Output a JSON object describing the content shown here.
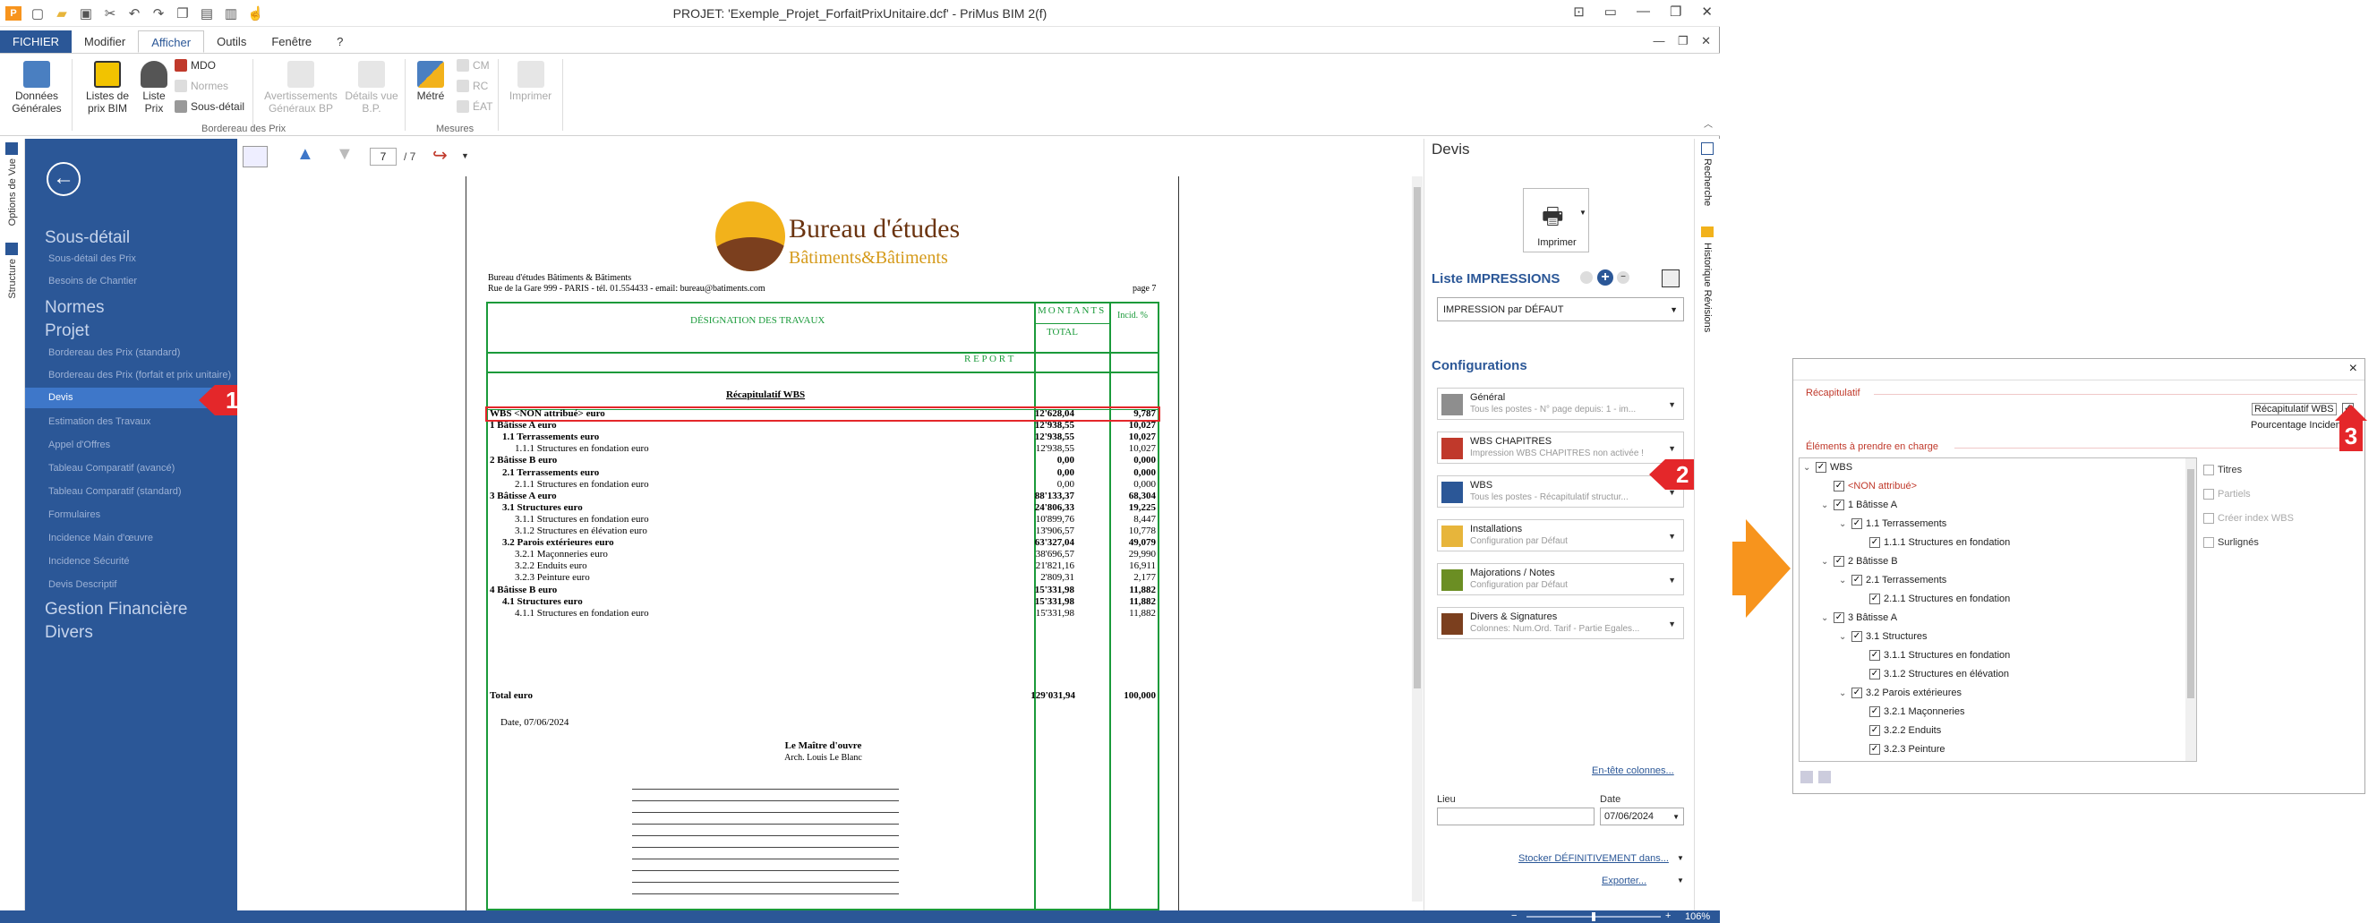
{
  "window": {
    "title": "PROJET: 'Exemple_Projet_ForfaitPrixUnitaire.dcf' - PriMus  BIM 2(f)"
  },
  "ribbon_tabs": [
    "FICHIER",
    "Modifier",
    "Afficher",
    "Outils",
    "Fenêtre",
    "?"
  ],
  "ribbon": {
    "donnees": "Données Générales",
    "listes_bim": "Listes de prix BIM",
    "liste_prix": "Liste Prix",
    "mdo": "MDO",
    "normes": "Normes",
    "sous_detail": "Sous-détail",
    "avertissements": "Avertissements Généraux BP",
    "details_vue": "Détails vue B.P.",
    "metre": "Métré",
    "cm": "CM",
    "rc": "RC",
    "eat": "ÉAT",
    "imprimer": "Imprimer",
    "group_bordereau": "Bordereau des Prix",
    "group_mesures": "Mesures"
  },
  "left_strip": {
    "options_vue": "Options de Vue",
    "structure": "Structure"
  },
  "nav": {
    "sous_detail": "Sous-détail",
    "sous_detail_prix": "Sous-détail des Prix",
    "besoins": "Besoins de Chantier",
    "normes": "Normes",
    "projet": "Projet",
    "bp_standard": "Bordereau des Prix (standard)",
    "bp_forfait": "Bordereau des Prix (forfait et prix unitaire)",
    "devis": "Devis",
    "estimation": "Estimation des Travaux",
    "appel": "Appel d'Offres",
    "tab_avance": "Tableau Comparatif (avancé)",
    "tab_standard": "Tableau Comparatif (standard)",
    "formulaires": "Formulaires",
    "incidence_mo": "Incidence Main d'œuvre",
    "incidence_sec": "Incidence Sécurité",
    "devis_desc": "Devis Descriptif",
    "gestion": "Gestion Financière",
    "divers": "Divers"
  },
  "callouts": {
    "c1": "1",
    "c2": "2",
    "c3": "3"
  },
  "doctoolbar": {
    "page_current": "7",
    "page_total": "/ 7"
  },
  "document": {
    "logo_title": "Bureau d'études",
    "logo_sub": "Bâtiments&Bâtiments",
    "company": "Bureau d'études Bâtiments & Bâtiments",
    "address": "Rue de la Gare 999 - PARIS - tél. 01.554433 - email: bureau@batiments.com",
    "page": "page 7",
    "col_designation": "DÉSIGNATION DES TRAVAUX",
    "col_montants": "MONTANTS",
    "col_total": "TOTAL",
    "col_incid": "Incid. %",
    "report": "R E P O R T",
    "recap_title": "Récapitulatif WBS",
    "rows": [
      {
        "label": "WBS <NON attribué> euro",
        "amount": "12'628,04",
        "pct": "9,787",
        "bold": true,
        "indent": 0
      },
      {
        "label": "1 Bâtisse A euro",
        "amount": "12'938,55",
        "pct": "10,027",
        "bold": true,
        "indent": 0
      },
      {
        "label": "1.1 Terrassements euro",
        "amount": "12'938,55",
        "pct": "10,027",
        "bold": true,
        "indent": 1
      },
      {
        "label": "1.1.1 Structures en fondation euro",
        "amount": "12'938,55",
        "pct": "10,027",
        "bold": false,
        "indent": 2
      },
      {
        "label": "2 Bâtisse B euro",
        "amount": "0,00",
        "pct": "0,000",
        "bold": true,
        "indent": 0
      },
      {
        "label": "2.1 Terrassements euro",
        "amount": "0,00",
        "pct": "0,000",
        "bold": true,
        "indent": 1
      },
      {
        "label": "2.1.1 Structures en fondation euro",
        "amount": "0,00",
        "pct": "0,000",
        "bold": false,
        "indent": 2
      },
      {
        "label": "3 Bâtisse A euro",
        "amount": "88'133,37",
        "pct": "68,304",
        "bold": true,
        "indent": 0
      },
      {
        "label": "3.1 Structures euro",
        "amount": "24'806,33",
        "pct": "19,225",
        "bold": true,
        "indent": 1
      },
      {
        "label": "3.1.1 Structures en fondation euro",
        "amount": "10'899,76",
        "pct": "8,447",
        "bold": false,
        "indent": 2
      },
      {
        "label": "3.1.2 Structures en élévation euro",
        "amount": "13'906,57",
        "pct": "10,778",
        "bold": false,
        "indent": 2
      },
      {
        "label": "3.2 Parois extérieures euro",
        "amount": "63'327,04",
        "pct": "49,079",
        "bold": true,
        "indent": 1
      },
      {
        "label": "3.2.1 Maçonneries euro",
        "amount": "38'696,57",
        "pct": "29,990",
        "bold": false,
        "indent": 2
      },
      {
        "label": "3.2.2 Enduits euro",
        "amount": "21'821,16",
        "pct": "16,911",
        "bold": false,
        "indent": 2
      },
      {
        "label": "3.2.3 Peinture euro",
        "amount": "2'809,31",
        "pct": "2,177",
        "bold": false,
        "indent": 2
      },
      {
        "label": "4 Bâtisse B euro",
        "amount": "15'331,98",
        "pct": "11,882",
        "bold": true,
        "indent": 0
      },
      {
        "label": "4.1 Structures euro",
        "amount": "15'331,98",
        "pct": "11,882",
        "bold": true,
        "indent": 1
      },
      {
        "label": "4.1.1 Structures en fondation euro",
        "amount": "15'331,98",
        "pct": "11,882",
        "bold": false,
        "indent": 2
      }
    ],
    "total_label": "Total euro",
    "total_amount": "129'031,94",
    "total_pct": "100,000",
    "date": "Date, 07/06/2024",
    "signer_title": "Le Maître d'ouvre",
    "signer_name": "Arch. Louis Le Blanc"
  },
  "panel": {
    "title": "Devis",
    "print_label": "Imprimer",
    "liste_title": "Liste IMPRESSIONS",
    "impression_select": "IMPRESSION par DÉFAUT",
    "config_title": "Configurations",
    "configs": [
      {
        "title": "Général",
        "sub": "Tous les postes - N° page depuis: 1 - im..."
      },
      {
        "title": "WBS CHAPITRES",
        "sub": "Impression WBS CHAPITRES non activée !"
      },
      {
        "title": "WBS",
        "sub": "Tous les postes - Récapitulatif structur..."
      },
      {
        "title": "Installations",
        "sub": "Configuration par Défaut"
      },
      {
        "title": "Majorations / Notes",
        "sub": "Configuration par Défaut"
      },
      {
        "title": "Divers & Signatures",
        "sub": "Colonnes: Num.Ord. Tarif - Partie Égales..."
      }
    ],
    "entete": "En-tête colonnes...",
    "lieu_label": "Lieu",
    "date_label": "Date",
    "date_value": "07/06/2024",
    "stocker": "Stocker DÉFINITIVEMENT dans...",
    "exporter": "Exporter..."
  },
  "right_strip": {
    "recherche": "Recherche",
    "historique": "Historique Révisions"
  },
  "status": {
    "zoom": "106%"
  },
  "dialog": {
    "close": "×",
    "recap_section": "Récapitulatif",
    "recap_wbs": "Récapitulatif WBS",
    "pourcentage": "Pourcentage Incidence",
    "elements_section": "Éléments à prendre en charge",
    "tree": [
      {
        "label": "WBS",
        "level": 0,
        "red": false
      },
      {
        "label": "<NON attribué>",
        "level": 1,
        "red": true
      },
      {
        "label": "1  Bâtisse A",
        "level": 1,
        "red": false
      },
      {
        "label": "1.1  Terrassements",
        "level": 2,
        "red": false
      },
      {
        "label": "1.1.1  Structures en fondation",
        "level": 3,
        "red": false
      },
      {
        "label": "2  Bâtisse B",
        "level": 1,
        "red": false
      },
      {
        "label": "2.1  Terrassements",
        "level": 2,
        "red": false
      },
      {
        "label": "2.1.1  Structures en fondation",
        "level": 3,
        "red": false
      },
      {
        "label": "3  Bâtisse A",
        "level": 1,
        "red": false
      },
      {
        "label": "3.1  Structures",
        "level": 2,
        "red": false
      },
      {
        "label": "3.1.1  Structures en fondation",
        "level": 3,
        "red": false
      },
      {
        "label": "3.1.2  Structures en élévation",
        "level": 3,
        "red": false
      },
      {
        "label": "3.2  Parois extérieures",
        "level": 2,
        "red": false
      },
      {
        "label": "3.2.1  Maçonneries",
        "level": 3,
        "red": false
      },
      {
        "label": "3.2.2  Enduits",
        "level": 3,
        "red": false
      },
      {
        "label": "3.2.3  Peinture",
        "level": 3,
        "red": false
      }
    ],
    "opt_titres": "Titres",
    "opt_partiels": "Partiels",
    "opt_index": "Créer index WBS",
    "opt_surlignes": "Surlignés"
  }
}
